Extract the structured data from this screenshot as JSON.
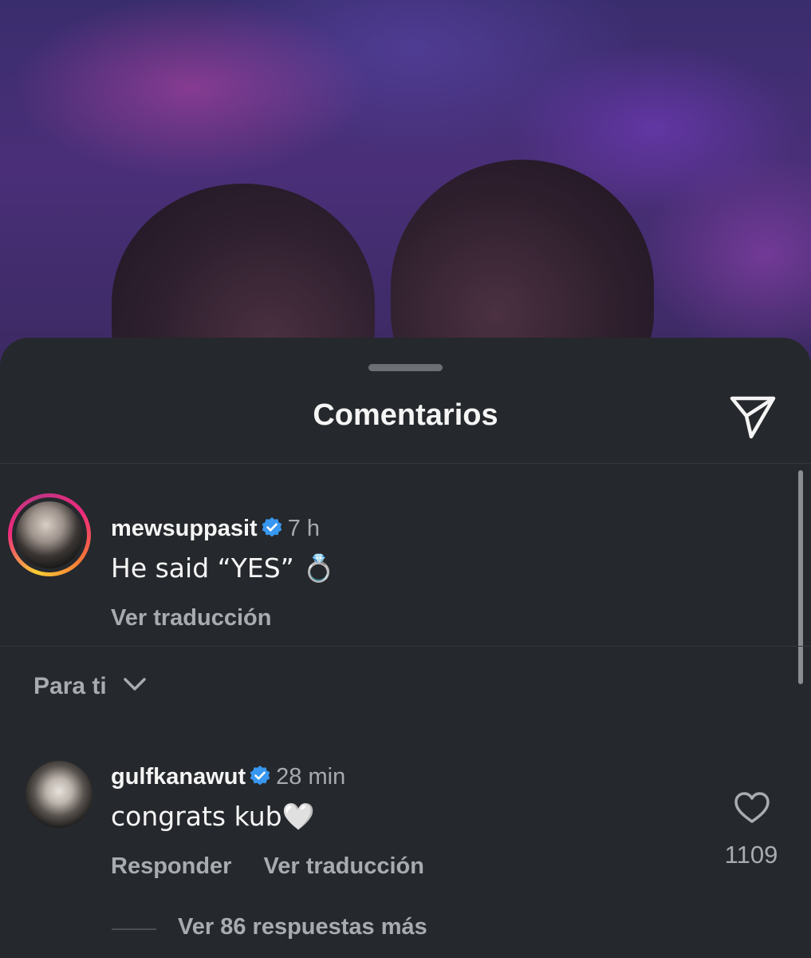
{
  "sheet": {
    "title": "Comentarios"
  },
  "comments": [
    {
      "username": "mewsuppasit",
      "time": "7 h",
      "text": "He said “YES” 💍",
      "actions": [
        "Ver traducción"
      ]
    },
    {
      "username": "gulfkanawut",
      "time": "28 min",
      "text": "congrats kub🤍",
      "actions": [
        "Responder",
        "Ver traducción"
      ],
      "likes": "1109",
      "replies": "Ver 86 respuestas más"
    }
  ],
  "filter": {
    "label": "Para ti"
  },
  "colors": {
    "sheet_bg": "#25282c",
    "verified": "#3897f0",
    "muted_text": "#a8abb0"
  },
  "icons": {
    "share": "paper-plane-icon",
    "verified": "verified-badge-icon",
    "like": "heart-icon",
    "filter": "chevron-down-icon"
  }
}
